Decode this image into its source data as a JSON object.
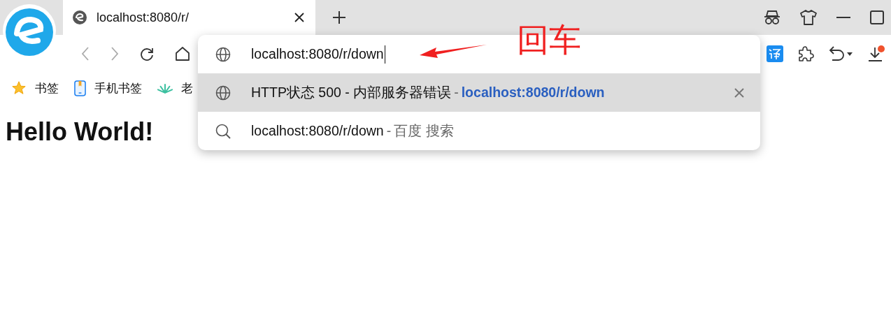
{
  "tabs": [
    {
      "title": "localhost:8080/r/",
      "selected": true
    }
  ],
  "bookmarks": [
    {
      "label": "书签",
      "kind": "star"
    },
    {
      "label": "手机书签",
      "kind": "phone"
    },
    {
      "label": "老",
      "kind": "plant"
    }
  ],
  "address_dropdown": {
    "input": "localhost:8080/r/down",
    "suggestions": [
      {
        "kind": "history",
        "title": "HTTP状态 500 - 内部服务器错误",
        "separator": "-",
        "url": "localhost:8080/r/down",
        "selected": true
      },
      {
        "kind": "search",
        "title": "localhost:8080/r/down",
        "separator": "-",
        "url": "百度 搜索",
        "selected": false
      }
    ]
  },
  "page": {
    "heading": "Hello World!"
  },
  "annotation": {
    "text": "回车"
  }
}
